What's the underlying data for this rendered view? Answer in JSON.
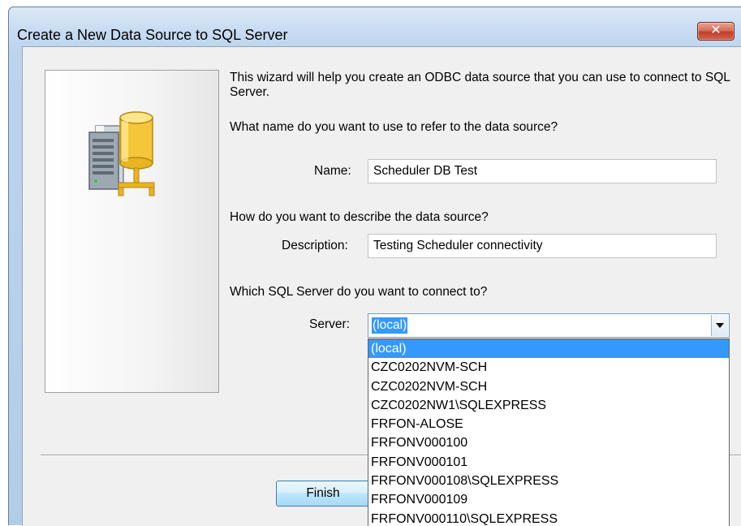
{
  "window": {
    "title": "Create a New Data Source to SQL Server",
    "close_glyph": "✕"
  },
  "wizard": {
    "intro": "This wizard will help you create an ODBC data source that you can use to connect to SQL Server.",
    "name_question": "What name do you want to use to refer to the data source?",
    "name_label": "Name:",
    "name_value": "Scheduler DB Test",
    "description_question": "How do you want to describe the data source?",
    "description_label": "Description:",
    "description_value": "Testing Scheduler connectivity",
    "server_question": "Which SQL Server do you want to connect to?",
    "server_label": "Server:",
    "server_value": "(local)"
  },
  "dropdown": {
    "options": [
      "(local)",
      "CZC0202NVM-SCH",
      "CZC0202NVM-SCH",
      "CZC0202NW1\\SQLEXPRESS",
      "FRFON-ALOSE",
      "FRFONV000100",
      "FRFONV000101",
      "FRFONV000108\\SQLEXPRESS",
      "FRFONV000109",
      "FRFONV000110\\SQLEXPRESS"
    ],
    "selected_index": 0
  },
  "buttons": {
    "finish": "Finish"
  },
  "icons": {
    "wizard_image": "database-server-icon",
    "dropdown_arrow": "chevron-down-icon",
    "close": "close-icon"
  },
  "colors": {
    "selection": "#3399ff",
    "title_gradient": "#c7dbf0",
    "client_bg": "#f0f0f0",
    "close_button": "#c13f2b"
  }
}
